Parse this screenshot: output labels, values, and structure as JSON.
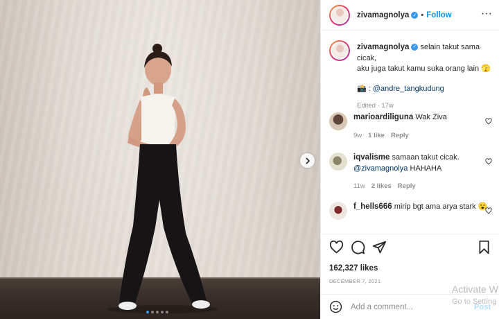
{
  "post": {
    "username": "zivamagnolya",
    "follow_label": "Follow",
    "caption_lines": [
      "selain takut sama cicak,",
      "aku juga takut kamu suka orang lain 🫣"
    ],
    "photo_credit_prefix": "📸 : ",
    "photo_credit_handle": "@andre_tangkudung",
    "edited_label": "Edited · 17w",
    "likes": "162,327 likes",
    "date": "DECEMBER 7, 2021",
    "carousel": {
      "total": 5,
      "active_index": 0
    }
  },
  "comments": [
    {
      "user": "marioardiliguna",
      "text": "Wak Ziva",
      "age": "9w",
      "likes": "1 like",
      "reply": "Reply"
    },
    {
      "user": "iqvalisme",
      "text": "samaan takut cicak.",
      "mention": "@zivamagnolya",
      "text2": " HAHAHA",
      "age": "11w",
      "likes": "2 likes",
      "reply": "Reply"
    },
    {
      "user": "f_hells666",
      "text": "mirip bgt ama arya stark 😮",
      "age": "",
      "likes": "",
      "reply": ""
    }
  ],
  "add_comment": {
    "placeholder": "Add a comment...",
    "post_label": "Post"
  },
  "watermark": {
    "line1": "Activate W",
    "line2": "Go to Setting"
  },
  "icons": [
    "more-icon",
    "verified-badge-icon",
    "heart-icon",
    "comment-icon",
    "share-icon",
    "bookmark-icon",
    "emoji-icon",
    "chevron-right-icon"
  ],
  "colors": {
    "accent": "#0095f6",
    "verified": "#3897f0",
    "muted": "#8e8e8e",
    "carousel_active": "#3b9cf5"
  }
}
